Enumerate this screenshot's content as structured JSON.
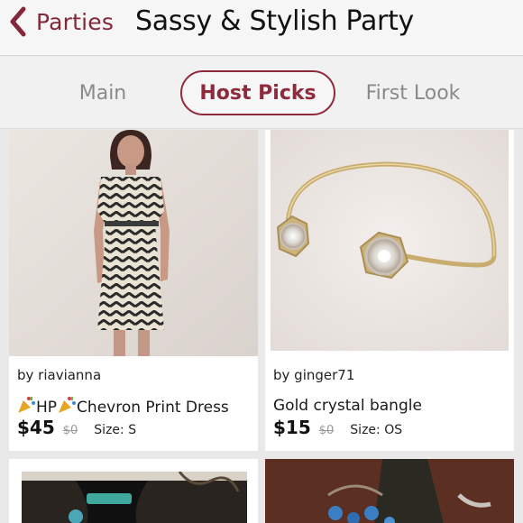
{
  "header": {
    "back_label": "Parties",
    "title": "Sassy & Stylish Party"
  },
  "tabs": [
    {
      "label": "Main",
      "active": false
    },
    {
      "label": "Host Picks",
      "active": true
    },
    {
      "label": "First Look",
      "active": false
    }
  ],
  "listings": [
    {
      "seller": "by riavianna",
      "title_prefix_icon": "party-popper-icon",
      "title_text": "HP",
      "title_middle_icon": "party-popper-icon",
      "title_rest": "Chevron Print Dress",
      "price": "$45",
      "original_price": "$0",
      "size": "Size: S"
    },
    {
      "seller": "by ginger71",
      "title_rest": "Gold crystal bangle",
      "price": "$15",
      "original_price": "$0",
      "size": "Size: OS"
    }
  ],
  "colors": {
    "accent": "#8e2a3c",
    "back_accent": "#822838",
    "background": "#e9e9e9"
  }
}
